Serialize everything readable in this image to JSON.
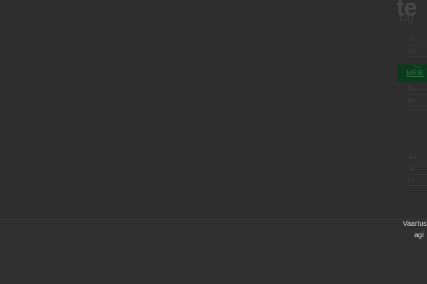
{
  "logo": {
    "big": "te",
    "small": "Lig"
  },
  "sidebar": {
    "group1": [
      "Al",
      "Ka"
    ],
    "active": {
      "sub": "Om",
      "label": "MEIE"
    },
    "group2": [
      "Pe",
      "Ko"
    ],
    "group3": [
      "Ra",
      "Ja",
      "Le"
    ]
  },
  "footer": {
    "line1": "Vaartus",
    "line2": "agi"
  },
  "colors": {
    "page_background": "#2e2e2e",
    "footer_background": "#303030",
    "active_nav": "#0b3b1c"
  }
}
